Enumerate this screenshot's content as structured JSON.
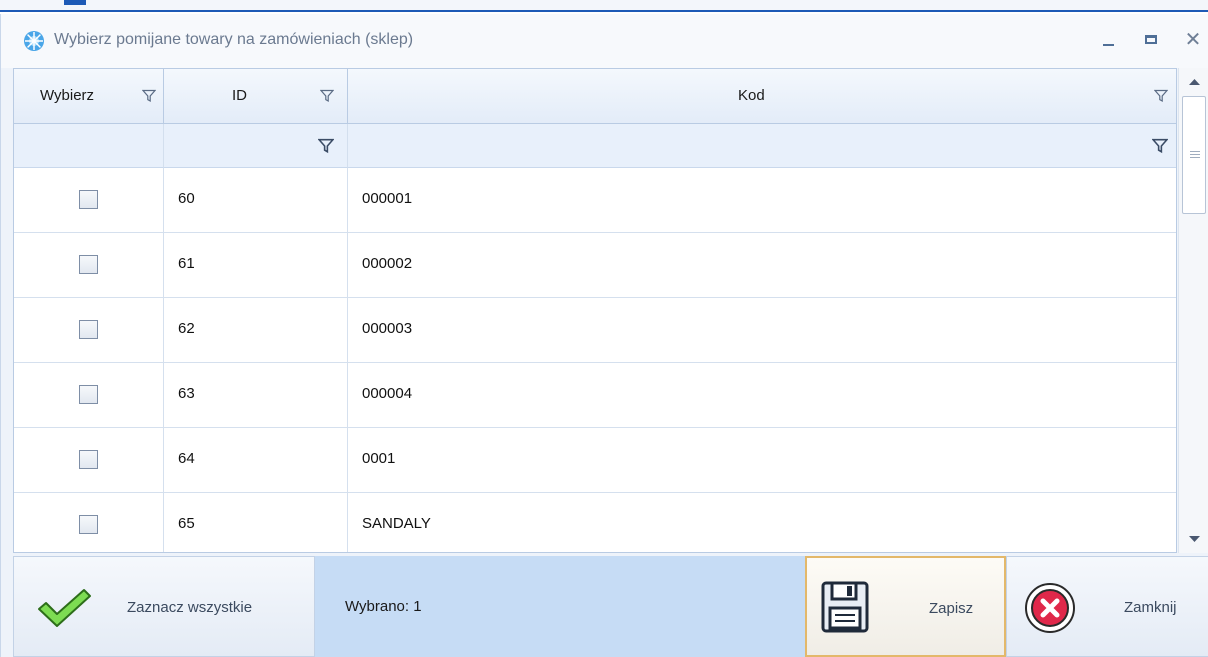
{
  "window": {
    "title": "Wybierz pomijane towary na zamówieniach (sklep)",
    "icon": "snowflake-app-icon",
    "controls": [
      "minimize-icon",
      "maximize-icon",
      "close-icon"
    ]
  },
  "grid": {
    "columns": [
      {
        "label": "Wybierz",
        "filter_icon": "filter-icon"
      },
      {
        "label": "ID",
        "filter_icon": "filter-icon"
      },
      {
        "label": "Kod",
        "filter_icon": "filter-icon"
      }
    ],
    "rows": [
      {
        "checked": false,
        "id": "60",
        "kod": "000001"
      },
      {
        "checked": false,
        "id": "61",
        "kod": "000002"
      },
      {
        "checked": false,
        "id": "62",
        "kod": "000003"
      },
      {
        "checked": false,
        "id": "63",
        "kod": "000004"
      },
      {
        "checked": false,
        "id": "64",
        "kod": "0001"
      },
      {
        "checked": false,
        "id": "65",
        "kod": "SANDALY"
      }
    ]
  },
  "footer": {
    "select_all_label": "Zaznacz wszystkie",
    "status_text": "Wybrano: 1",
    "save_label": "Zapisz",
    "close_label": "Zamknij"
  },
  "colors": {
    "accent": "#1d5ab6",
    "header_bg": "#e3ecf8",
    "status_bg": "#c6dcf5",
    "check_green": "#5cc23a",
    "close_red": "#d81c3a"
  }
}
